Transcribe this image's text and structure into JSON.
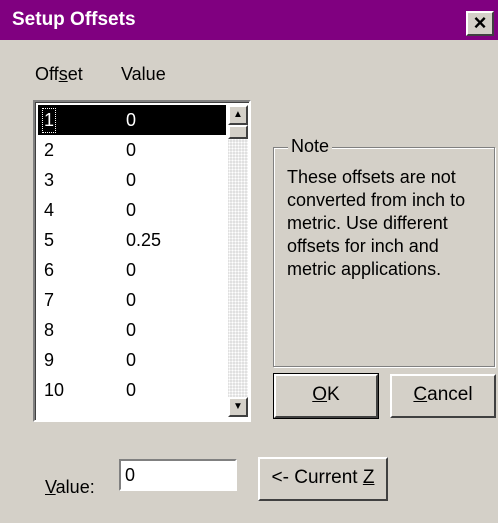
{
  "window": {
    "title": "Setup Offsets",
    "close_glyph": "×"
  },
  "list": {
    "header_offset": "Offset",
    "header_value": "Value",
    "selected_index": 0,
    "rows": [
      {
        "offset": "1",
        "value": "0"
      },
      {
        "offset": "2",
        "value": "0"
      },
      {
        "offset": "3",
        "value": "0"
      },
      {
        "offset": "4",
        "value": "0"
      },
      {
        "offset": "5",
        "value": "0.25"
      },
      {
        "offset": "6",
        "value": "0"
      },
      {
        "offset": "7",
        "value": "0"
      },
      {
        "offset": "8",
        "value": "0"
      },
      {
        "offset": "9",
        "value": "0"
      },
      {
        "offset": "10",
        "value": "0"
      }
    ]
  },
  "note": {
    "legend": "Note",
    "text": "These offsets are not converted from inch to metric.  Use different offsets for inch and metric applications."
  },
  "buttons": {
    "ok_label": "OK",
    "cancel_label": "Cancel",
    "current_z_label": "<- Current Z"
  },
  "value_field": {
    "label": "Value:",
    "value": "0"
  },
  "colors": {
    "titlebar": "#800080",
    "dialog_bg": "#d4d0c8",
    "selection": "#000000"
  }
}
